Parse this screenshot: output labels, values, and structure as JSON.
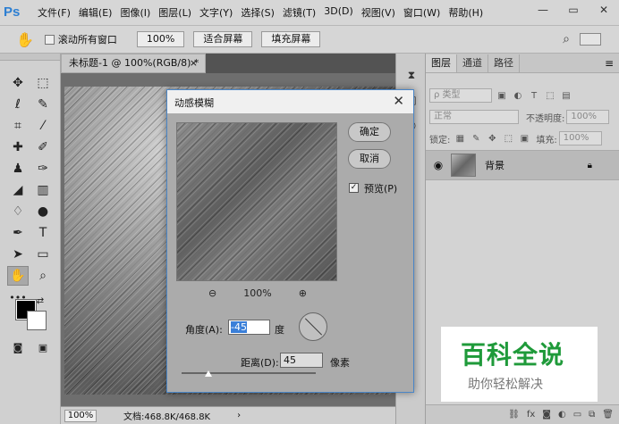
{
  "menubar": {
    "logo": "Ps",
    "items": [
      "文件(F)",
      "编辑(E)",
      "图像(I)",
      "图层(L)",
      "文字(Y)",
      "选择(S)",
      "滤镜(T)",
      "3D(D)",
      "视图(V)",
      "窗口(W)",
      "帮助(H)"
    ],
    "minimize": "—",
    "restore": "▭",
    "close": "✕"
  },
  "optbar": {
    "tool_icon": "hand-icon",
    "scroll_all_label": "滚动所有窗口",
    "zoom_value": "100%",
    "fit_screen_label": "适合屏幕",
    "fill_screen_label": "填充屏幕"
  },
  "document": {
    "tab_title": "未标题-1 @ 100%(RGB/8) *",
    "tab_close": "×",
    "status_zoom": "100%",
    "status_doc": "文档:468.8K/468.8K",
    "status_arrow": "›"
  },
  "layers_panel": {
    "tabs": [
      "图层",
      "通道",
      "路径"
    ],
    "filter_label": "ρ 类型",
    "blend_mode": "正常",
    "opacity_label": "不透明度:",
    "opacity_value": "100%",
    "lock_label": "锁定:",
    "fill_label": "填充:",
    "fill_value": "100%",
    "layer_name": "背景",
    "bottom_icons": [
      "link-icon",
      "fx-icon",
      "mask-icon",
      "adjustment-icon",
      "folder-icon",
      "new-layer-icon",
      "trash-icon"
    ]
  },
  "dialog": {
    "title": "动感模糊",
    "ok_label": "确定",
    "cancel_label": "取消",
    "preview_label": "预览(P)",
    "preview_checked": true,
    "zoom_value": "100%",
    "angle_label": "角度(A):",
    "angle_value": "-45",
    "angle_unit": "度",
    "distance_label": "距离(D):",
    "distance_value": "45",
    "distance_unit": "像素",
    "distance_slider_fraction": 0.2
  },
  "watermark": {
    "title": "百科全说",
    "subtitle": "助你轻松解决",
    "color": "#1f9a3a"
  }
}
